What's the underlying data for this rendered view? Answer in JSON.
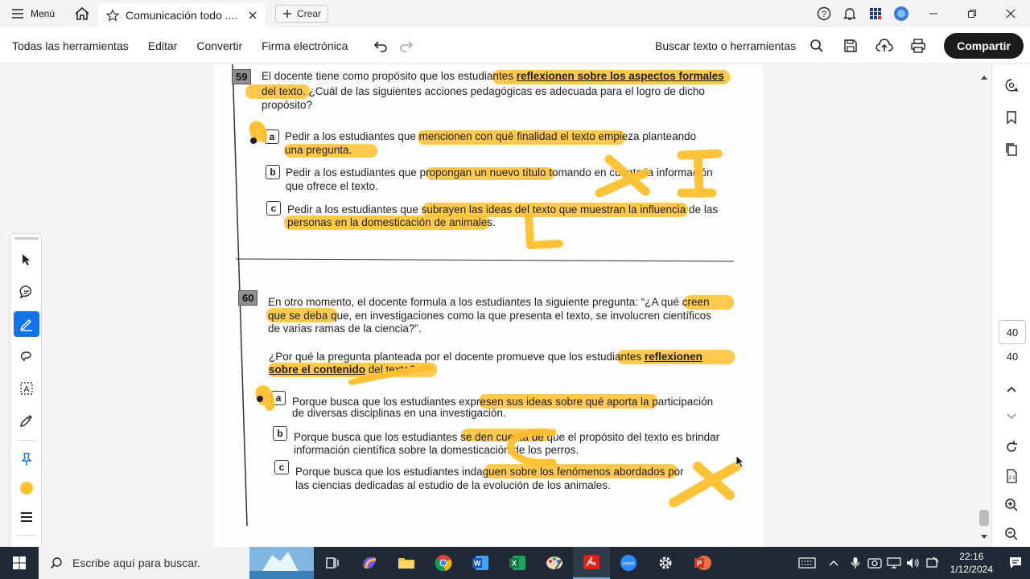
{
  "titlebar": {
    "menu_label": "Menú",
    "tab_title": "Comunicación todo ....",
    "create_label": "Crear"
  },
  "toolbar": {
    "all_tools": "Todas las herramientas",
    "edit": "Editar",
    "convert": "Convertir",
    "esign": "Firma electrónica",
    "search_label": "Buscar texto o herramientas",
    "share_label": "Compartir"
  },
  "document": {
    "q59": {
      "number": "59",
      "line1a": "El docente tiene como propósito que los estudiantes ",
      "line1b": "reflexionen sobre los aspectos formales",
      "line2a": "del texto",
      "line2b": ". ¿Cuál de las siguientes acciones pedagógicas es adecuada para el logro de dicho",
      "line3": "propósito?",
      "a1": "Pedir a los estudiantes que mencionen con qué finalidad el texto empieza planteando",
      "a2": "una pregunta.",
      "b1": "Pedir a los estudiantes que propongan un nuevo título tomando en cuenta la información",
      "b2": "que ofrece el texto.",
      "c1": "Pedir a los estudiantes que subrayen las ideas del texto que muestran la influencia de las",
      "c2": "personas en la domesticación de animales."
    },
    "q60": {
      "number": "60",
      "p1": "En otro momento, el docente formula a los estudiantes la siguiente pregunta: “¿A qué creen",
      "p2": "que se deba que, en investigaciones como la que presenta el texto, se involucren científicos",
      "p3": "de varias ramas de la ciencia?”.",
      "q1a": "¿Por qué la pregunta planteada por el docente promueve que los estudiantes ",
      "q1b": "reflexionen",
      "q2a": "sobre el contenido",
      "q2b": " del texto?",
      "a1": "Porque busca que los estudiantes expresen sus ideas sobre qué aporta la participación",
      "a2": "de diversas disciplinas en una investigación.",
      "b1": "Porque busca que los estudiantes se den cuenta de que el propósito del texto es brindar",
      "b2": "información científica sobre la domesticación de los perros.",
      "c1": "Porque busca que los estudiantes indaguen sobre los fenómenos abordados por",
      "c2": "las ciencias dedicadas al estudio de la evolución de los animales."
    },
    "option_letters": [
      "a",
      "b",
      "c"
    ]
  },
  "pages": {
    "current": "40",
    "total": "40"
  },
  "taskbar": {
    "search_placeholder": "Escribe aquí para buscar.",
    "time": "22:16",
    "date": "1/12/2024"
  },
  "colors": {
    "highlight": "#ffbf2e",
    "active_tool": "#1473e6",
    "taskbar_bg": "#1f2a36"
  }
}
